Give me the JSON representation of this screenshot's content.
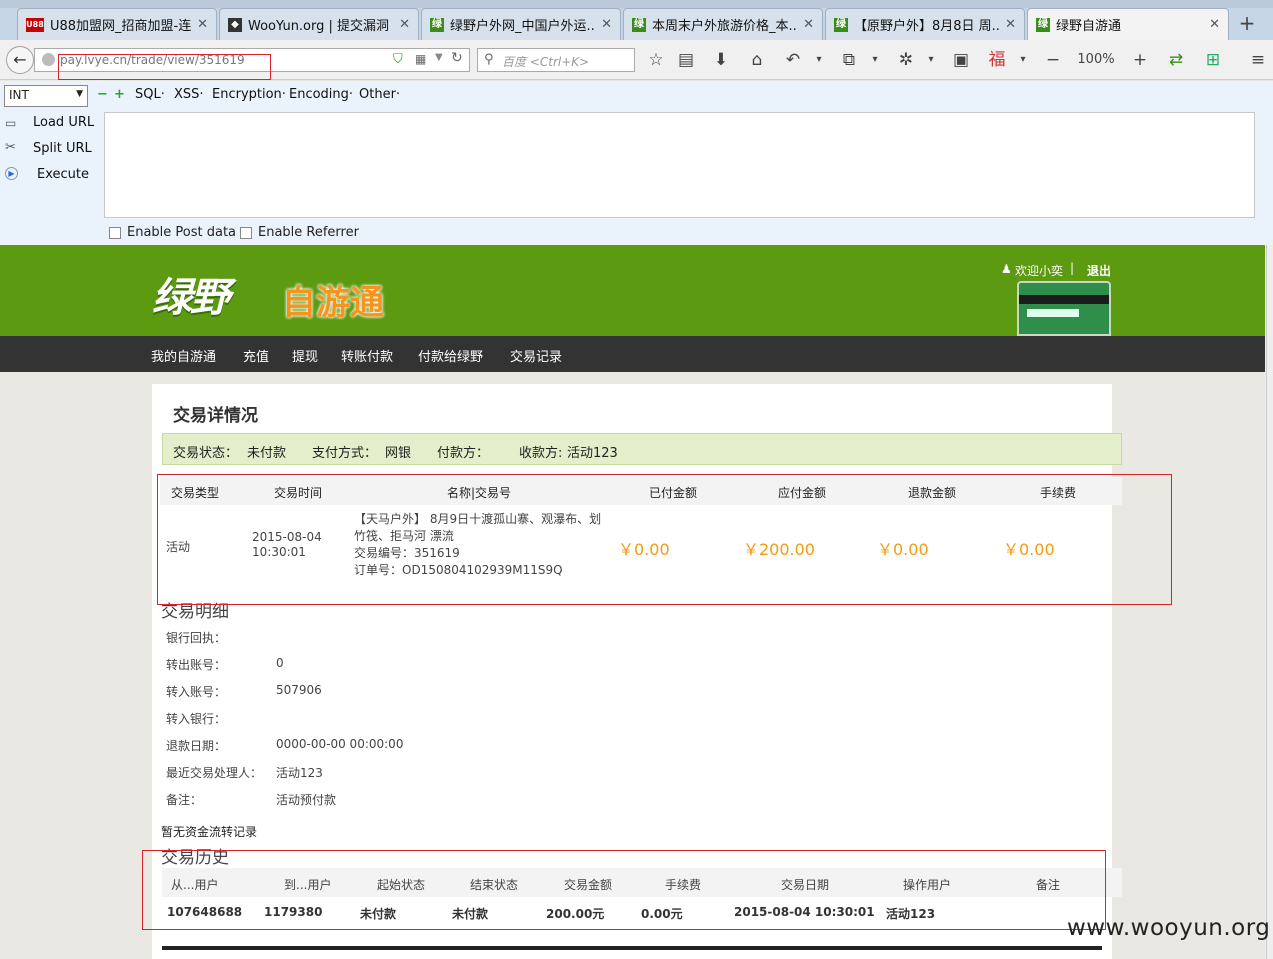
{
  "browser": {
    "tabs": [
      {
        "title": "U88加盟网_招商加盟-连...",
        "icon": "U88",
        "color": "#c00"
      },
      {
        "title": "WooYun.org | 提交漏洞",
        "icon": "",
        "color": "#333"
      },
      {
        "title": "绿野户外网_中国户外运...",
        "icon": "绿",
        "color": "#3a8d1a"
      },
      {
        "title": "本周末户外旅游价格_本...",
        "icon": "绿",
        "color": "#3a8d1a"
      },
      {
        "title": "【原野户外】8月8日 周...",
        "icon": "绿",
        "color": "#3a8d1a"
      },
      {
        "title": "绿野自游通",
        "icon": "绿",
        "color": "#3a8d1a"
      }
    ],
    "url": "pay.lvye.cn/trade/view/351619",
    "search_placeholder": "百度 <Ctrl+K>",
    "zoom": "100%"
  },
  "hackbar": {
    "select": "INT",
    "menus": [
      "SQL·",
      "XSS·",
      "Encryption·",
      "Encoding·",
      "Other·"
    ],
    "actions": [
      "Load URL",
      "Split URL",
      "Execute"
    ],
    "post_label": "Enable Post data",
    "referrer_label": "Enable Referrer"
  },
  "site": {
    "logo_main": "绿野",
    "logo_sub": "自游通",
    "welcome": "欢迎小奕",
    "logout": "退出",
    "nav": [
      "我的自游通",
      "充值",
      "提现",
      "转账付款",
      "付款给绿野",
      "交易记录"
    ]
  },
  "trade": {
    "title": "交易详情况",
    "status_label": "交易状态：",
    "status": "未付款",
    "pay_label": "支付方式：",
    "pay": "网银",
    "payer_label": "付款方：",
    "payee_label": "收款方:",
    "payee": "活动123",
    "headers": [
      "交易类型",
      "交易时间",
      "名称|交易号",
      "已付金额",
      "应付金额",
      "退款金额",
      "手续费"
    ],
    "row": {
      "type": "活动",
      "time": "2015-08-04 10:30:01",
      "name": "【天马户外】 8月9日十渡孤山寨、观瀑布、划竹筏、拒马河 漂流",
      "trade_no": "交易编号：351619",
      "order_no": "订单号：OD150804102939M11S9Q",
      "paid": "￥0.00",
      "due": "￥200.00",
      "refund": "￥0.00",
      "fee": "￥0.00"
    }
  },
  "detail": {
    "title": "交易明细",
    "rows": [
      {
        "label": "银行回执：",
        "value": ""
      },
      {
        "label": "转出账号：",
        "value": "0"
      },
      {
        "label": "转入账号：",
        "value": "507906"
      },
      {
        "label": "转入银行：",
        "value": ""
      },
      {
        "label": "退款日期：",
        "value": "0000-00-00 00:00:00"
      },
      {
        "label": "最近交易处理人：",
        "value": "活动123"
      },
      {
        "label": "备注：",
        "value": "活动预付款"
      }
    ],
    "no_flow": "暂无资金流转记录"
  },
  "history": {
    "title": "交易历史",
    "headers": [
      "从...用户",
      "到...用户",
      "起始状态",
      "结束状态",
      "交易金额",
      "手续费",
      "交易日期",
      "操作用户",
      "备注"
    ],
    "row": [
      "107648688",
      "1179380",
      "未付款",
      "未付款",
      "200.00元",
      "0.00元",
      "2015-08-04 10:30:01",
      "活动123",
      ""
    ]
  },
  "watermark": "www.wooyun.org"
}
